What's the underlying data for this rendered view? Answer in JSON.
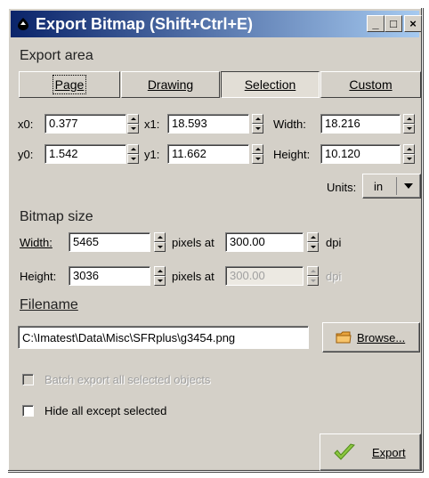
{
  "window": {
    "title": "Export Bitmap (Shift+Ctrl+E)",
    "minimize": "_",
    "maximize": "□",
    "close": "×"
  },
  "export_area": {
    "heading": "Export area",
    "tabs": [
      "Page",
      "Drawing",
      "Selection",
      "Custom"
    ],
    "selected_tab": "Selection",
    "x0_label": "x0:",
    "x0": "0.377",
    "x1_label": "x1:",
    "x1": "18.593",
    "width_label": "Width:",
    "width": "18.216",
    "y0_label": "y0:",
    "y0": "1.542",
    "y1_label": "y1:",
    "y1": "11.662",
    "height_label": "Height:",
    "height": "10.120",
    "units_label": "Units:",
    "units": "in"
  },
  "bitmap_size": {
    "heading": "Bitmap size",
    "width_label": "Width:",
    "width": "5465",
    "height_label": "Height:",
    "height": "3036",
    "pixels_at_label": "pixels at",
    "dpi_x": "300.00",
    "dpi_y": "300.00",
    "dpi_label": "dpi"
  },
  "filename": {
    "heading": "Filename",
    "path": "C:\\Imatest\\Data\\Misc\\SFRplus\\g3454.png",
    "browse_label": "Browse..."
  },
  "options": {
    "batch_export": "Batch export all selected objects",
    "hide_all": "Hide all except selected"
  },
  "export_button": "Export"
}
